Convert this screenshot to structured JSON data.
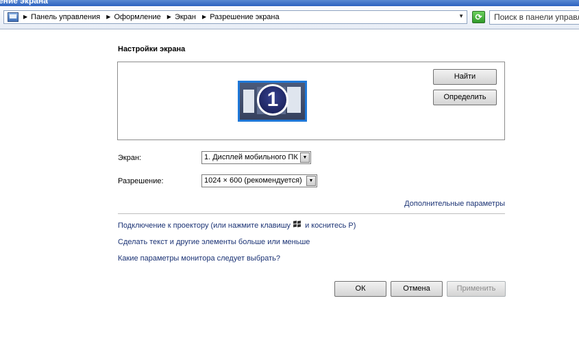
{
  "window": {
    "title_fragment": "ение экрана"
  },
  "address_bar": {
    "crumbs": [
      "Панель управления",
      "Оформление",
      "Экран",
      "Разрешение экрана"
    ],
    "search_placeholder": "Поиск в панели управле"
  },
  "main": {
    "heading": "Настройки экрана",
    "identify_buttons": {
      "find": "Найти",
      "detect": "Определить"
    },
    "monitor_number": "1",
    "display_label": "Экран:",
    "display_value": "1. Дисплей мобильного ПК",
    "resolution_label": "Разрешение:",
    "resolution_value": "1024 × 600 (рекомендуется)",
    "advanced_link": "Дополнительные параметры",
    "links": {
      "projector_pre": "Подключение к проектору (или нажмите клавишу",
      "projector_post": "и коснитесь P)",
      "text_size": "Сделать текст и другие элементы больше или меньше",
      "which_params": "Какие параметры монитора следует выбрать?"
    },
    "buttons": {
      "ok": "ОК",
      "cancel": "Отмена",
      "apply": "Применить"
    }
  }
}
